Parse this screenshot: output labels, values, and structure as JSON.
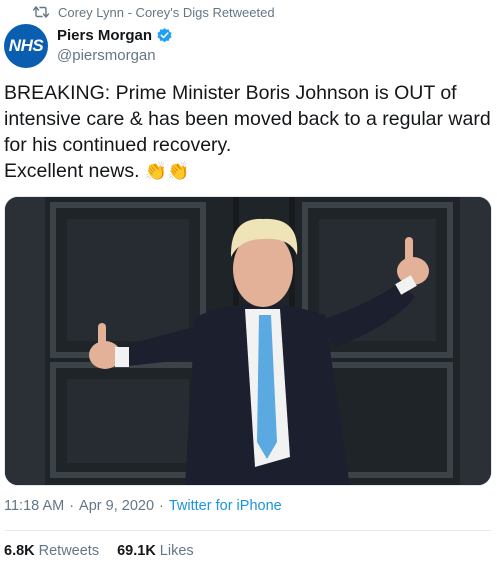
{
  "retweet": {
    "icon": "retweet-icon",
    "text": "Corey Lynn - Corey's Digs Retweeted"
  },
  "author": {
    "avatar_label": "NHS",
    "avatar_color": "#0a5eb0",
    "name": "Piers Morgan",
    "verified_icon": "verified-badge-icon",
    "verified_color": "#1da1f2",
    "handle": "@piersmorgan"
  },
  "tweet": {
    "text": "BREAKING: Prime Minister Boris Johnson is OUT of intensive care & has been moved back to a regular ward for his continued recovery.\nExcellent news. ",
    "emoji": "👏👏"
  },
  "photo": {
    "icon": "photo-image"
  },
  "meta": {
    "time": "11:18 AM",
    "separator": "·",
    "date": "Apr 9, 2020",
    "source": "Twitter for iPhone",
    "source_color": "#1b95e0"
  },
  "stats": {
    "retweets_count": "6.8K",
    "retweets_label": "Retweets",
    "likes_count": "69.1K",
    "likes_label": "Likes"
  }
}
